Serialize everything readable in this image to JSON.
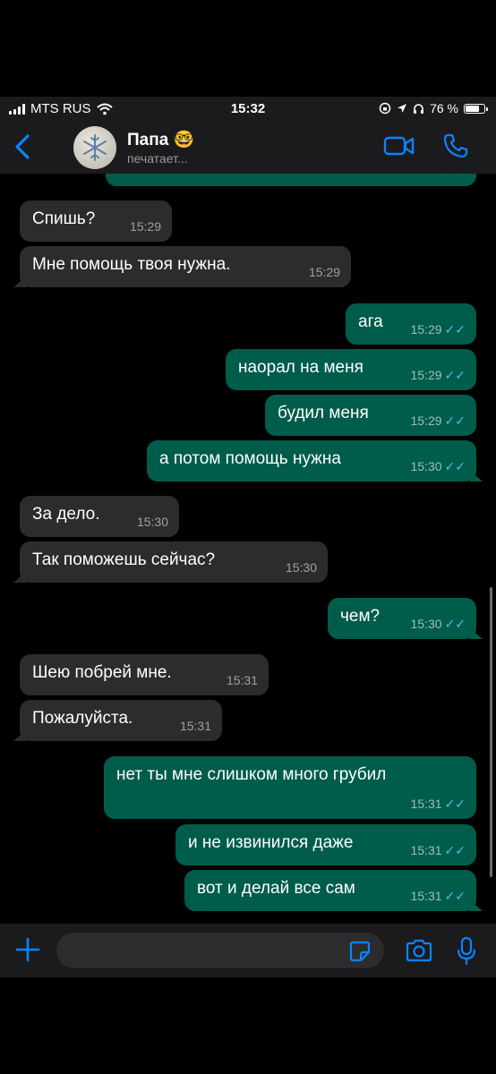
{
  "status_bar": {
    "carrier": "MTS RUS",
    "time": "15:32",
    "battery": "76 %",
    "battery_level": 0.76
  },
  "header": {
    "contact_name": "Папа 🤓",
    "status": "печатает..."
  },
  "icons": {
    "back": "chevron-left-icon",
    "video": "video-camera-icon",
    "call": "phone-icon",
    "read": "double-check-icon"
  },
  "colors": {
    "incoming": "#2c2c2e",
    "outgoing": "#005c4b",
    "accent": "#0a84ff",
    "read_check": "#53bdeb"
  },
  "messages": [
    {
      "direction": "in",
      "text": "Спишь?",
      "time": "15:29"
    },
    {
      "direction": "in",
      "text": "Мне помощь твоя нужна.",
      "time": "15:29"
    },
    {
      "direction": "out",
      "text": "ага",
      "time": "15:29"
    },
    {
      "direction": "out",
      "text": "наорал на меня",
      "time": "15:29"
    },
    {
      "direction": "out",
      "text": "будил меня",
      "time": "15:29"
    },
    {
      "direction": "out",
      "text": "а потом помощь нужна",
      "time": "15:30"
    },
    {
      "direction": "in",
      "text": "За дело.",
      "time": "15:30"
    },
    {
      "direction": "in",
      "text": "Так поможешь сейчас?",
      "time": "15:30"
    },
    {
      "direction": "out",
      "text": "чем?",
      "time": "15:30"
    },
    {
      "direction": "in",
      "text": "Шею побрей мне.",
      "time": "15:31"
    },
    {
      "direction": "in",
      "text": "Пожалуйста.",
      "time": "15:31"
    },
    {
      "direction": "out",
      "text": "нет ты мне слишком много грубил",
      "time": "15:31"
    },
    {
      "direction": "out",
      "text": "и не извинился даже",
      "time": "15:31"
    },
    {
      "direction": "out",
      "text": "вот и делай все сам",
      "time": "15:31"
    }
  ],
  "input": {
    "value": ""
  }
}
